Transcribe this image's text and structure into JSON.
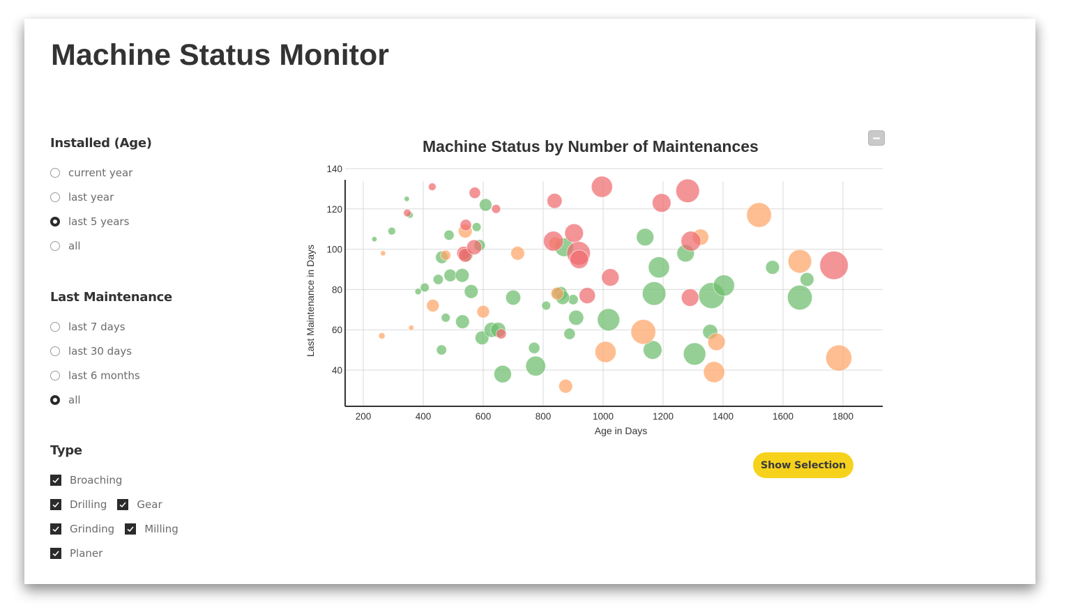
{
  "page": {
    "title": "Machine Status Monitor"
  },
  "filters": {
    "installed": {
      "heading": "Installed (Age)",
      "options": [
        {
          "label": "current year",
          "checked": false
        },
        {
          "label": "last year",
          "checked": false
        },
        {
          "label": "last 5 years",
          "checked": true
        },
        {
          "label": "all",
          "checked": false
        }
      ]
    },
    "maintenance": {
      "heading": "Last Maintenance",
      "options": [
        {
          "label": "last 7 days",
          "checked": false
        },
        {
          "label": "last 30 days",
          "checked": false
        },
        {
          "label": "last 6 months",
          "checked": false
        },
        {
          "label": "all",
          "checked": true
        }
      ]
    },
    "type": {
      "heading": "Type",
      "options": [
        {
          "label": "Broaching",
          "checked": true
        },
        {
          "label": "Drilling",
          "checked": true
        },
        {
          "label": "Gear",
          "checked": true
        },
        {
          "label": "Grinding",
          "checked": true
        },
        {
          "label": "Milling",
          "checked": true
        },
        {
          "label": "Planer",
          "checked": true
        }
      ]
    }
  },
  "actions": {
    "show_selection": "Show Selection",
    "collapse_icon": "minus-icon"
  },
  "colors": {
    "ok": "#6cbd6c",
    "warning": "#fda566",
    "critical": "#ef6b6f",
    "button": "#f7d21c"
  },
  "chart_data": {
    "type": "scatter",
    "subtype": "bubble",
    "title": "Machine Status by Number of Maintenances",
    "xlabel": "Age in Days",
    "ylabel": "Last Maintenance in Days",
    "xlim": [
      140,
      1940
    ],
    "ylim": [
      22,
      143
    ],
    "xticks": [
      200,
      400,
      600,
      800,
      1000,
      1200,
      1400,
      1600,
      1800
    ],
    "yticks": [
      40,
      60,
      80,
      100,
      120,
      140
    ],
    "grid": true,
    "legend": "none",
    "size_meaning": "number of maintenances (relative)",
    "series": [
      {
        "name": "ok",
        "color": "#6cbd6c",
        "points": [
          [
            237,
            105,
            1
          ],
          [
            295,
            109,
            2
          ],
          [
            345,
            125,
            1
          ],
          [
            356,
            117,
            1.5
          ],
          [
            383,
            79,
            1.5
          ],
          [
            405,
            81,
            2.5
          ],
          [
            450,
            85,
            3
          ],
          [
            462,
            96,
            4
          ],
          [
            475,
            66,
            2.5
          ],
          [
            486,
            107,
            3
          ],
          [
            490,
            87,
            4
          ],
          [
            531,
            64,
            4.5
          ],
          [
            530,
            87,
            4.5
          ],
          [
            545,
            97,
            4
          ],
          [
            560,
            79,
            4.5
          ],
          [
            578,
            111,
            2.5
          ],
          [
            588,
            102,
            3.5
          ],
          [
            596,
            56,
            4.5
          ],
          [
            608,
            122,
            4
          ],
          [
            628,
            60,
            5
          ],
          [
            650,
            60,
            5
          ],
          [
            665,
            38,
            6
          ],
          [
            700,
            76,
            5
          ],
          [
            770,
            51,
            3.5
          ],
          [
            775,
            42,
            7
          ],
          [
            850,
            78,
            4
          ],
          [
            858,
            78,
            4.5
          ],
          [
            888,
            58,
            3.5
          ],
          [
            900,
            75,
            3
          ],
          [
            910,
            66,
            5
          ],
          [
            1018,
            65,
            8
          ],
          [
            1140,
            106,
            6
          ],
          [
            1165,
            50,
            6.5
          ],
          [
            1170,
            78,
            8.5
          ],
          [
            1186,
            91,
            7.5
          ],
          [
            1275,
            98,
            6
          ],
          [
            1305,
            48,
            8
          ],
          [
            1357,
            59,
            5
          ],
          [
            1362,
            77,
            9.5
          ],
          [
            1403,
            82,
            7.5
          ],
          [
            1565,
            91,
            4.5
          ],
          [
            1656,
            76,
            9
          ],
          [
            1680,
            85,
            4.5
          ],
          [
            870,
            101,
            6.5
          ],
          [
            865,
            76,
            4.5
          ],
          [
            810,
            72,
            2.5
          ],
          [
            461,
            50,
            3
          ]
        ]
      },
      {
        "name": "warning",
        "color": "#fda566",
        "points": [
          [
            262,
            57,
            1.5
          ],
          [
            266,
            98,
            1
          ],
          [
            360,
            61,
            1
          ],
          [
            432,
            72,
            4
          ],
          [
            475,
            97,
            3
          ],
          [
            540,
            109,
            4.5
          ],
          [
            600,
            69,
            4
          ],
          [
            715,
            98,
            4.5
          ],
          [
            847,
            78,
            4
          ],
          [
            875,
            32,
            4.5
          ],
          [
            1008,
            49,
            7.5
          ],
          [
            1134,
            59,
            9
          ],
          [
            1325,
            106,
            5.5
          ],
          [
            1378,
            54,
            6
          ],
          [
            1370,
            39,
            7.5
          ],
          [
            1520,
            117,
            9
          ],
          [
            1656,
            94,
            8.5
          ],
          [
            1786,
            46,
            9.5
          ],
          [
            840,
            103,
            4
          ]
        ]
      },
      {
        "name": "critical",
        "color": "#ef6b6f",
        "points": [
          [
            347,
            118,
            2
          ],
          [
            430,
            131,
            2
          ],
          [
            535,
            98,
            4.5
          ],
          [
            540,
            97,
            4.5
          ],
          [
            542,
            112,
            3.5
          ],
          [
            570,
            101,
            5
          ],
          [
            572,
            128,
            3.5
          ],
          [
            643,
            120,
            2.5
          ],
          [
            660,
            58,
            3
          ],
          [
            838,
            124,
            5
          ],
          [
            834,
            104,
            7
          ],
          [
            903,
            108,
            6.5
          ],
          [
            918,
            98,
            8.5
          ],
          [
            920,
            95,
            6.5
          ],
          [
            947,
            77,
            5.5
          ],
          [
            996,
            131,
            7.5
          ],
          [
            1024,
            86,
            6
          ],
          [
            1195,
            123,
            6.5
          ],
          [
            1282,
            129,
            8.5
          ],
          [
            1290,
            76,
            6
          ],
          [
            1293,
            104,
            7
          ],
          [
            1770,
            92,
            10.5
          ]
        ]
      }
    ]
  }
}
